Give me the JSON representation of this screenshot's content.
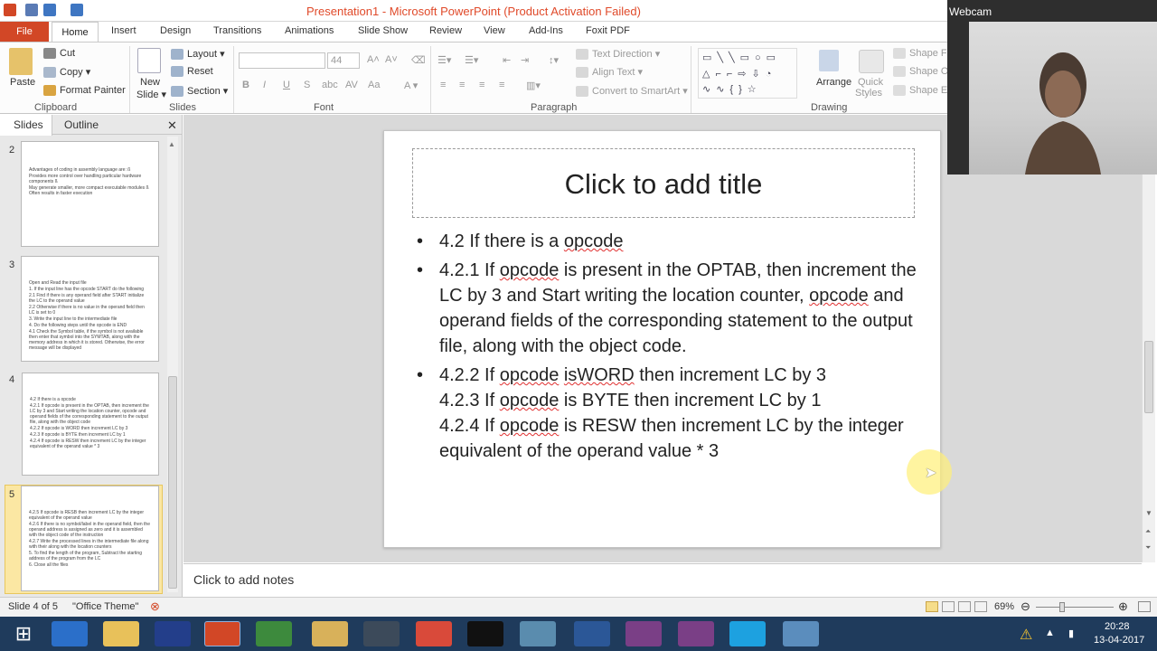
{
  "window": {
    "title": "Presentation1 - Microsoft PowerPoint (Product Activation Failed)"
  },
  "ribbon_tabs": [
    "File",
    "Home",
    "Insert",
    "Design",
    "Transitions",
    "Animations",
    "Slide Show",
    "Review",
    "View",
    "Add-Ins",
    "Foxit PDF"
  ],
  "clipboard": {
    "paste": "Paste",
    "cut": "Cut",
    "copy": "Copy",
    "format_painter": "Format Painter",
    "label": "Clipboard"
  },
  "slides_group": {
    "new_slide": "New",
    "new_slide2": "Slide",
    "layout": "Layout",
    "reset": "Reset",
    "section": "Section",
    "label": "Slides"
  },
  "font_group": {
    "size": "44",
    "label": "Font"
  },
  "paragraph_group": {
    "text_direction": "Text Direction",
    "align_text": "Align Text",
    "convert": "Convert to SmartArt",
    "label": "Paragraph"
  },
  "drawing_group": {
    "arrange": "Arrange",
    "quick_styles": "Quick",
    "quick_styles2": "Styles",
    "shape_fill": "Shape Fil",
    "shape_outline": "Shape Ou",
    "shape_effects": "Shape Ef",
    "label": "Drawing"
  },
  "pane": {
    "tab_slides": "Slides",
    "tab_outline": "Outline"
  },
  "thumbnails": [
    {
      "num": "2",
      "lines": [
        "Advantages of coding in assembly language are: ß",
        "Provides more control over handling particular hardware components ß",
        "May generate smaller, more compact executable modules ß Often results in faster execution"
      ]
    },
    {
      "num": "3",
      "lines": [
        "Open and Read the input file",
        "1. If the input line has the opcode START do the following",
        "2.1 Find if there is any operand field after START initialize the LC to the operand value",
        "2.2 Otherwise if there is no value in the operand field then LC is set to 0",
        "3. Write the input line to the intermediate file",
        "4. Do the following steps until the opcode is END",
        "4.1 Check the Symbol table, if the symbol is not available then enter that symbol into the SYMTAB, along with the memory address in which it is stored. Otherwise, the error message will be displayed"
      ]
    },
    {
      "num": "4",
      "lines": [
        "4.2 If there is a opcode",
        "4.2.1 If opcode is present in the OPTAB, then increment the LC by 3 and Start writing the location counter, opcode and operand fields of the corresponding statement to the output file, along with the object code",
        "4.2.2 If opcode is WORD then increment LC by 3",
        "4.2.3 If opcode is BYTE then increment LC by 1",
        "4.2.4 If opcode is RESW then increment LC by the integer equivalent of the operand value * 3"
      ]
    },
    {
      "num": "5",
      "lines": [
        "4.2.5 If opcode is RESB then increment LC by the integer equivalent of the operand value",
        "4.2.6 If there is no symbol/label in the operand field, then the operand address is assigned as zero and it is assembled with the object code of the instruction",
        "4.2.7 Write the processed lines in the intermediate file along with their along with the location counters",
        "5. To find the length of the program, Subtract the starting address of the program from the LC",
        "6. Close all the files"
      ]
    }
  ],
  "slide": {
    "title": "Click to add title",
    "b1": "4.2 If there is a ",
    "b1w": "opcode",
    "b2a": " 4.2.1  If ",
    "b2w": "opcode",
    "b2b": " is present in the OPTAB, then increment the LC by 3 and Start writing the location counter, ",
    "b2w2": "opcode",
    "b2c": " and operand fields of the corresponding statement to the output file, along with the object code.",
    "b3a": "4.2.2 If ",
    "b3w": "opcode",
    "b3w2": "isWORD",
    "b3b": " then increment LC by 3",
    "b3c": "4.2.3 If ",
    "b3w3": "opcode",
    "b3d": " is BYTE then increment LC by 1",
    "b3e": "4.2.4 If ",
    "b3w4": "opcode",
    "b3f": " is RESW then increment LC by the integer equivalent of the operand value * 3"
  },
  "notes": "Click to add notes",
  "status": {
    "slide": "Slide 4 of 5",
    "theme": "\"Office Theme\"",
    "zoom": "69%"
  },
  "webcam": "Webcam",
  "clock": {
    "time": "20:28",
    "date": "13-04-2017"
  },
  "colors": {
    "file_tab": "#d24726",
    "taskbar": "#1f3b5c",
    "selection": "#fbe7a3"
  }
}
